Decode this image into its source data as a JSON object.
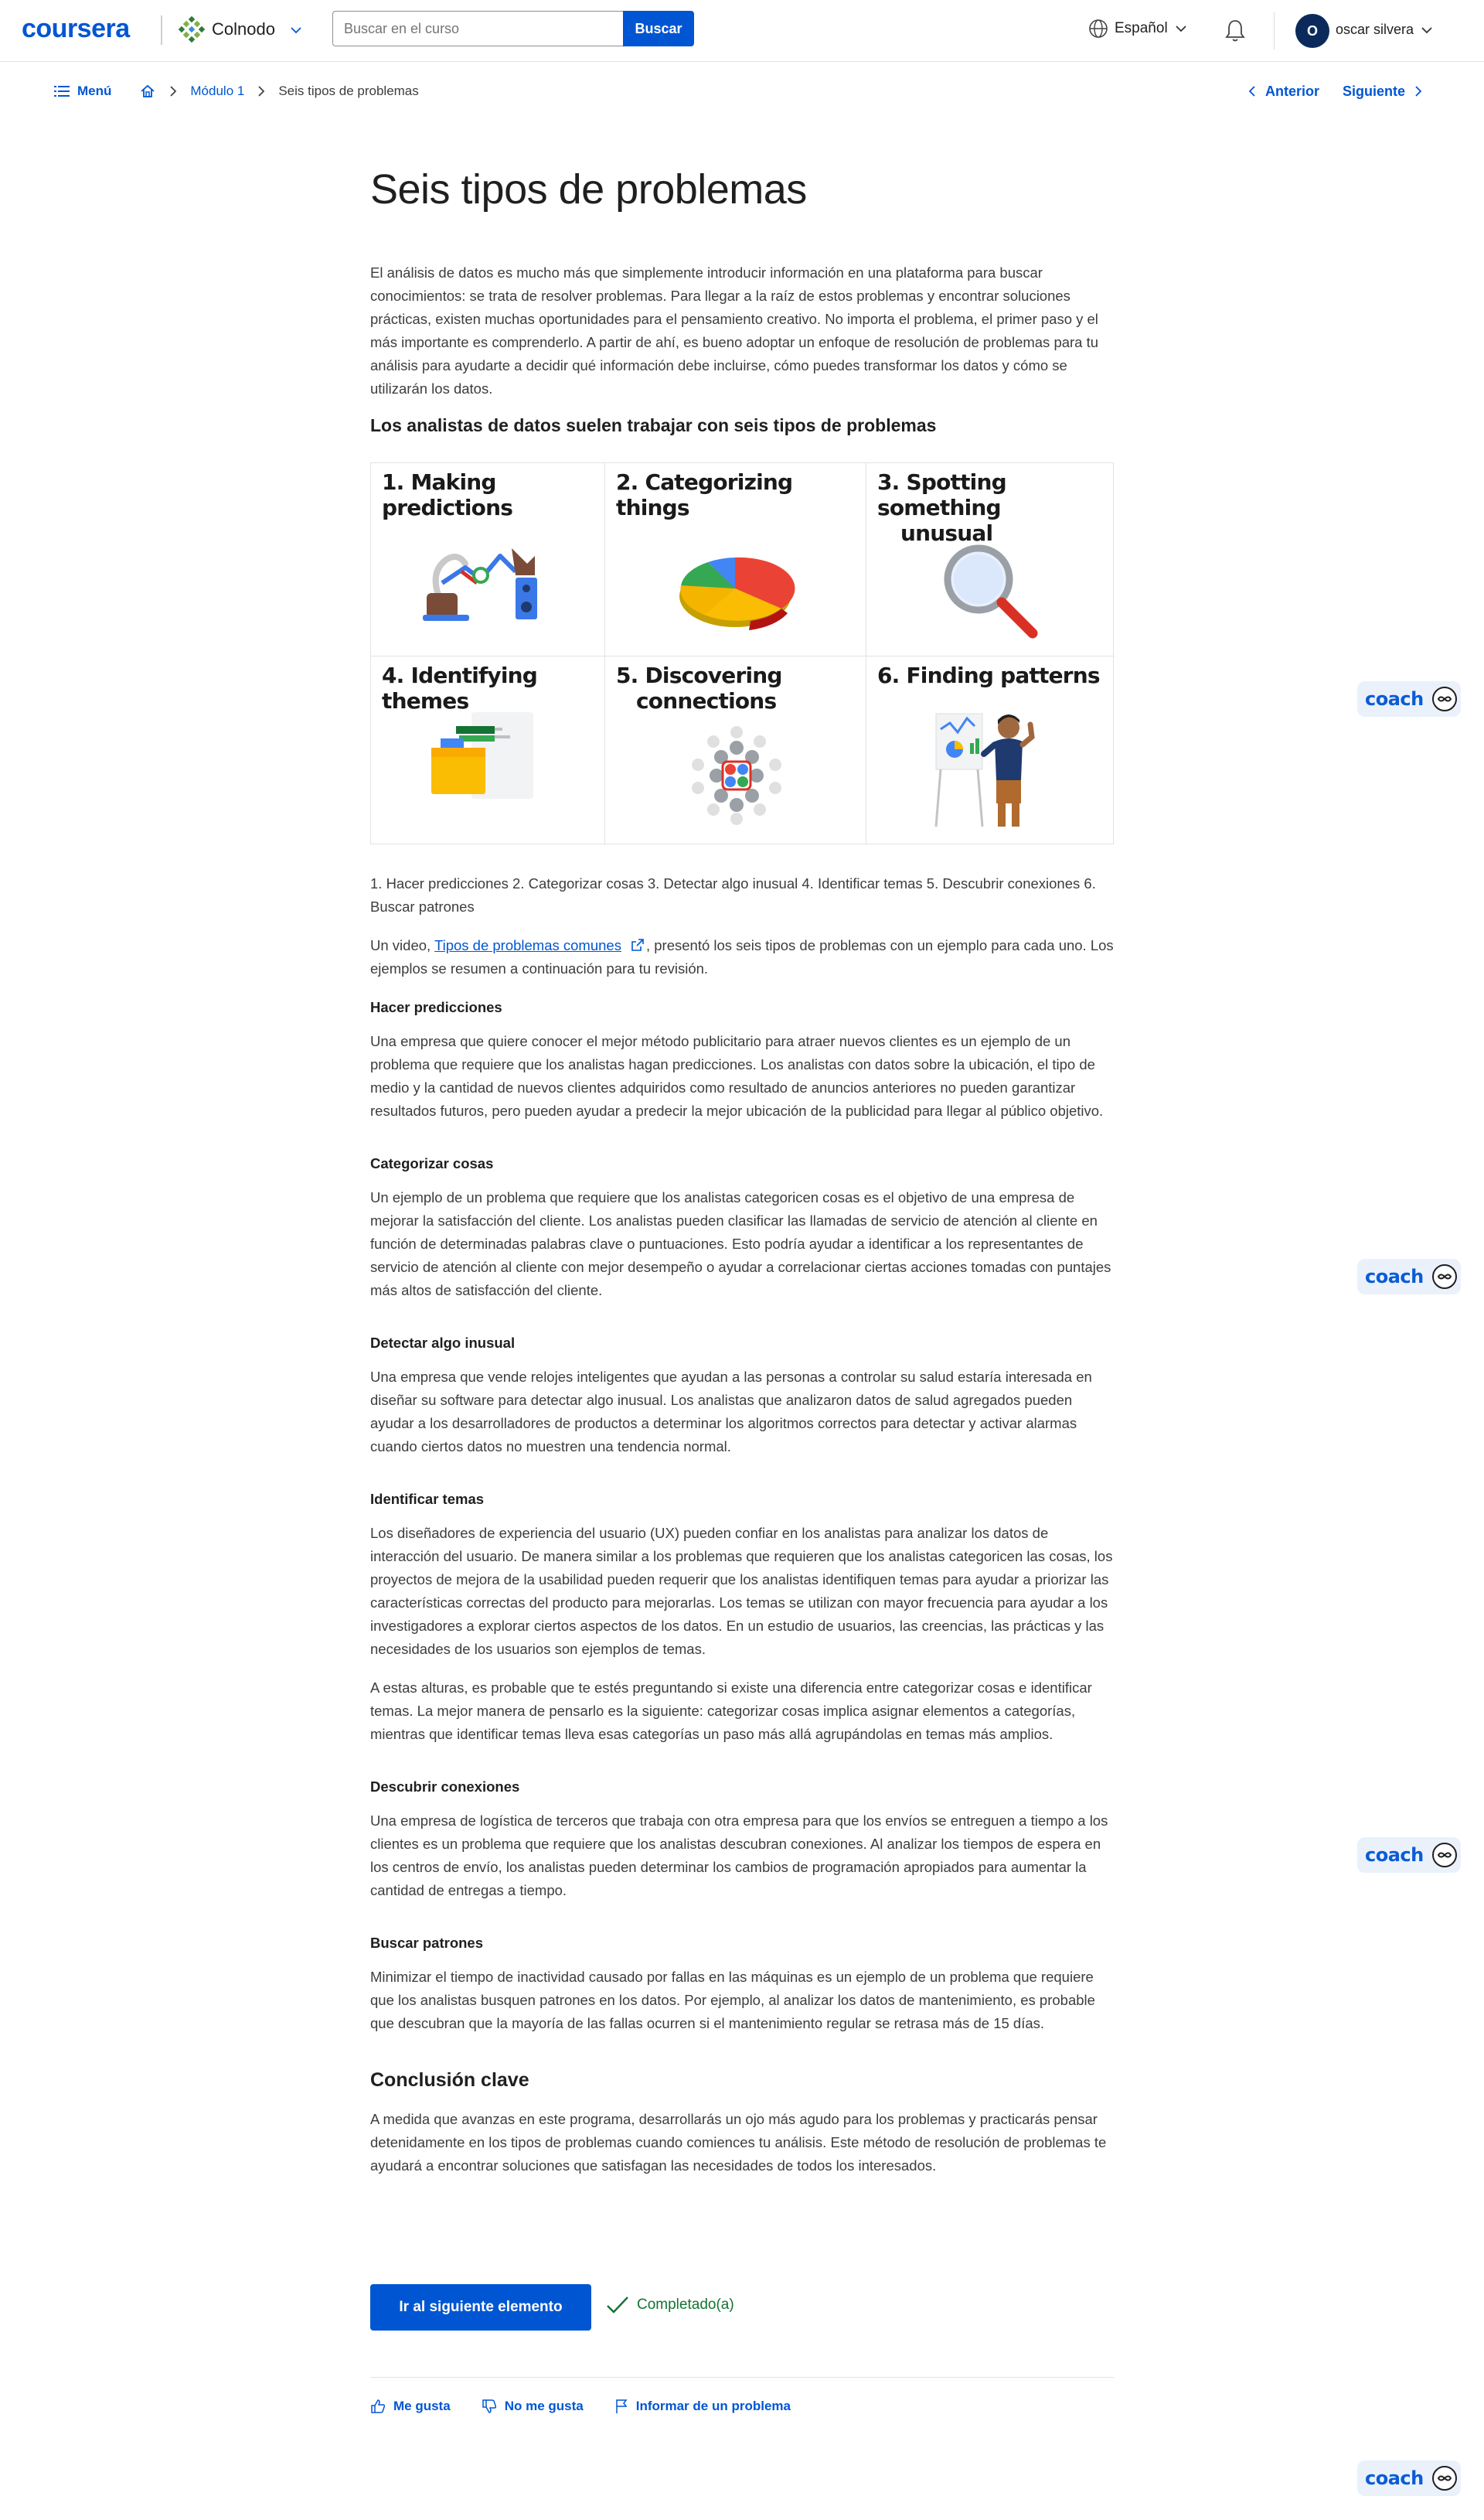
{
  "header": {
    "logo": "coursera",
    "partner": "Colnodo",
    "search_placeholder": "Buscar en el curso",
    "search_button": "Buscar",
    "language": "Español",
    "avatar_initial": "O",
    "user_name": "oscar silvera"
  },
  "breadcrumb": {
    "menu": "Menú",
    "module": "Módulo 1",
    "current": "Seis tipos de problemas",
    "prev": "Anterior",
    "next": "Siguiente"
  },
  "article": {
    "title": "Seis tipos de problemas",
    "intro": "El análisis de datos es mucho más que simplemente introducir información en una plataforma para buscar conocimientos: se trata de resolver problemas. Para llegar a la raíz de estos problemas y encontrar soluciones prácticas, existen muchas oportunidades para el pensamiento creativo. No importa el problema, el primer paso y el más importante es comprenderlo. A partir de ahí, es bueno adoptar un enfoque de resolución de problemas para tu análisis para ayudarte a decidir qué información debe incluirse, cómo puedes transformar los datos y cómo se utilizarán los datos.",
    "section_heading": "Los analistas de datos suelen trabajar con seis tipos de problemas",
    "grid": [
      {
        "title_line1": "1. Making predictions",
        "title_line2": ""
      },
      {
        "title_line1": "2. Categorizing things",
        "title_line2": ""
      },
      {
        "title_line1": "3. Spotting something",
        "title_line2": "unusual"
      },
      {
        "title_line1": "4. Identifying themes",
        "title_line2": ""
      },
      {
        "title_line1": "5. Discovering",
        "title_line2": "connections"
      },
      {
        "title_line1": "6. Finding patterns",
        "title_line2": ""
      }
    ],
    "caption": "1. Hacer predicciones 2. Categorizar cosas 3. Detectar algo inusual 4. Identificar temas 5. Descubrir conexiones 6. Buscar patrones",
    "video_prefix": "Un video, ",
    "video_link": "Tipos de problemas comunes",
    "video_suffix": ", presentó los seis tipos de problemas con un ejemplo para cada uno. Los ejemplos se resumen a continuación para tu revisión.",
    "sections": [
      {
        "heading": "Hacer predicciones",
        "paragraphs": [
          "Una empresa que quiere conocer el mejor método publicitario para atraer nuevos clientes es un ejemplo de un problema que requiere que los analistas hagan predicciones. Los analistas con datos sobre la ubicación, el tipo de medio y la cantidad de nuevos clientes adquiridos como resultado de anuncios anteriores no pueden garantizar resultados futuros, pero pueden ayudar a predecir la mejor ubicación de la publicidad para llegar al público objetivo."
        ]
      },
      {
        "heading": "Categorizar cosas",
        "paragraphs": [
          "Un ejemplo de un problema que requiere que los analistas categoricen cosas es el objetivo de una empresa de mejorar la satisfacción del cliente. Los analistas pueden clasificar las llamadas de servicio de atención al cliente en función de determinadas palabras clave o puntuaciones. Esto podría ayudar a identificar a los representantes de servicio de atención al cliente con mejor desempeño o ayudar a correlacionar ciertas acciones tomadas con puntajes más altos de satisfacción del cliente."
        ]
      },
      {
        "heading": "Detectar algo inusual",
        "paragraphs": [
          "Una empresa que vende relojes inteligentes que ayudan a las personas a controlar su salud estaría interesada en diseñar su software para detectar algo inusual. Los analistas que analizaron datos de salud agregados pueden ayudar a los desarrolladores de productos a determinar los algoritmos correctos para detectar y activar alarmas cuando ciertos datos no muestren una tendencia normal."
        ]
      },
      {
        "heading": "Identificar temas",
        "paragraphs": [
          "Los diseñadores de experiencia del usuario (UX) pueden confiar en los analistas para analizar los datos de interacción del usuario. De manera similar a los problemas que requieren que los analistas categoricen las cosas, los proyectos de mejora de la usabilidad pueden requerir que los analistas identifiquen temas para ayudar a priorizar las características correctas del producto para mejorarlas. Los temas se utilizan con mayor frecuencia para ayudar a los investigadores a explorar ciertos aspectos de los datos. En un estudio de usuarios, las creencias, las prácticas y las necesidades de los usuarios son ejemplos de temas.",
          "A estas alturas, es probable que te estés preguntando si existe una diferencia entre categorizar cosas e identificar temas. La mejor manera de pensarlo es la siguiente: categorizar cosas implica asignar elementos a categorías, mientras que identificar temas lleva esas categorías un paso más allá agrupándolas en temas más amplios."
        ]
      },
      {
        "heading": "Descubrir conexiones",
        "paragraphs": [
          "Una empresa de logística de terceros que trabaja con otra empresa para que los envíos se entreguen a tiempo a los clientes es un problema que requiere que los analistas descubran conexiones. Al analizar los tiempos de espera en los centros de envío, los analistas pueden determinar los cambios de programación apropiados para aumentar la cantidad de entregas a tiempo."
        ]
      },
      {
        "heading": "Buscar patrones",
        "paragraphs": [
          "Minimizar el tiempo de inactividad causado por fallas en las máquinas es un ejemplo de un problema que requiere que los analistas busquen patrones en los datos. Por ejemplo, al analizar los datos de mantenimiento, es probable que descubran que la mayoría de las fallas ocurren si el mantenimiento regular se retrasa más de 15 días."
        ]
      }
    ],
    "conclusion_heading": "Conclusión clave",
    "conclusion": "A medida que avanzas en este programa, desarrollarás un ojo más agudo para los problemas y practicarás pensar detenidamente en los tipos de problemas cuando comiences tu análisis. Este método de resolución de problemas te ayudará a encontrar soluciones que satisfagan las necesidades de todos los interesados."
  },
  "footer": {
    "next_button": "Ir al siguiente elemento",
    "completed": "Completado(a)",
    "like": "Me gusta",
    "dislike": "No me gusta",
    "report": "Informar de un problema"
  },
  "coach_label": "coach",
  "colors": {
    "brand": "#0056d2",
    "success": "#137333",
    "coach_bg": "#eaf1fb"
  }
}
